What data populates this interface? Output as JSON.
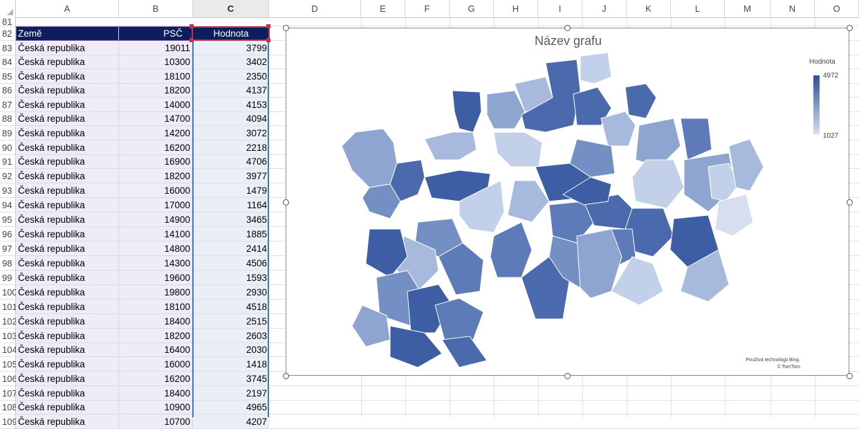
{
  "columns": [
    "A",
    "B",
    "C",
    "D",
    "E",
    "F",
    "G",
    "H",
    "I",
    "J",
    "K",
    "L",
    "M",
    "N",
    "O"
  ],
  "selected_column": "C",
  "first_row_number": "81",
  "header_row": {
    "row": "82",
    "zeme": "Země",
    "psc": "PSČ",
    "hodnota": "Hodnota"
  },
  "rows": [
    {
      "row": "83",
      "zeme": "Česká republika",
      "psc": "19011",
      "hodnota": "3799"
    },
    {
      "row": "84",
      "zeme": "Česká republika",
      "psc": "10300",
      "hodnota": "3402"
    },
    {
      "row": "85",
      "zeme": "Česká republika",
      "psc": "18100",
      "hodnota": "2350"
    },
    {
      "row": "86",
      "zeme": "Česká republika",
      "psc": "18200",
      "hodnota": "4137"
    },
    {
      "row": "87",
      "zeme": "Česká republika",
      "psc": "14000",
      "hodnota": "4153"
    },
    {
      "row": "88",
      "zeme": "Česká republika",
      "psc": "14700",
      "hodnota": "4094"
    },
    {
      "row": "89",
      "zeme": "Česká republika",
      "psc": "14200",
      "hodnota": "3072"
    },
    {
      "row": "90",
      "zeme": "Česká republika",
      "psc": "16200",
      "hodnota": "2218"
    },
    {
      "row": "91",
      "zeme": "Česká republika",
      "psc": "16900",
      "hodnota": "4706"
    },
    {
      "row": "92",
      "zeme": "Česká republika",
      "psc": "18200",
      "hodnota": "3977"
    },
    {
      "row": "93",
      "zeme": "Česká republika",
      "psc": "16000",
      "hodnota": "1479"
    },
    {
      "row": "94",
      "zeme": "Česká republika",
      "psc": "17000",
      "hodnota": "1164"
    },
    {
      "row": "95",
      "zeme": "Česká republika",
      "psc": "14900",
      "hodnota": "3465"
    },
    {
      "row": "96",
      "zeme": "Česká republika",
      "psc": "14100",
      "hodnota": "1885"
    },
    {
      "row": "97",
      "zeme": "Česká republika",
      "psc": "14800",
      "hodnota": "2414"
    },
    {
      "row": "98",
      "zeme": "Česká republika",
      "psc": "14300",
      "hodnota": "4506"
    },
    {
      "row": "99",
      "zeme": "Česká republika",
      "psc": "19600",
      "hodnota": "1593"
    },
    {
      "row": "100",
      "zeme": "Česká republika",
      "psc": "19800",
      "hodnota": "2930"
    },
    {
      "row": "101",
      "zeme": "Česká republika",
      "psc": "18100",
      "hodnota": "4518"
    },
    {
      "row": "102",
      "zeme": "Česká republika",
      "psc": "18400",
      "hodnota": "2515"
    },
    {
      "row": "103",
      "zeme": "Česká republika",
      "psc": "18200",
      "hodnota": "2603"
    },
    {
      "row": "104",
      "zeme": "Česká republika",
      "psc": "16400",
      "hodnota": "2030"
    },
    {
      "row": "105",
      "zeme": "Česká republika",
      "psc": "16000",
      "hodnota": "1418"
    },
    {
      "row": "106",
      "zeme": "Česká republika",
      "psc": "16200",
      "hodnota": "3745"
    },
    {
      "row": "107",
      "zeme": "Česká republika",
      "psc": "18400",
      "hodnota": "2197"
    },
    {
      "row": "108",
      "zeme": "Česká republika",
      "psc": "10900",
      "hodnota": "4965"
    },
    {
      "row": "109",
      "zeme": "Česká republika",
      "psc": "10700",
      "hodnota": "4207"
    }
  ],
  "chart": {
    "title": "Název grafu",
    "legend_title": "Hodnota",
    "legend_max": "4972",
    "legend_min": "1027",
    "attribution_line1": "Používá technologii Bing.",
    "attribution_line2": "© TomTom",
    "color_high": "#2e4f95",
    "color_low": "#d6dff0"
  },
  "colors": {
    "header_fill": "#0c1e5b",
    "table_band": "#efebf7",
    "selection_border": "#4472c4",
    "active_cell_border": "#c0314e"
  }
}
